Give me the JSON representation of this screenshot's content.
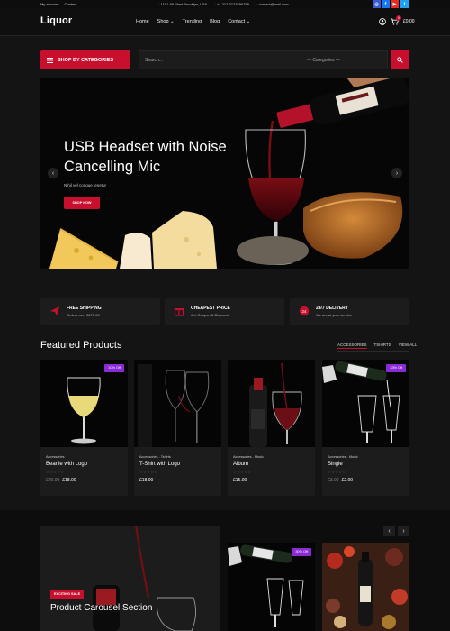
{
  "topbar": {
    "links": [
      "My account",
      "Contact"
    ],
    "contacts": [
      "1101-95 West Brooklyn, USA",
      "+1 212-0123456789",
      "contact@mail.com"
    ],
    "social": [
      {
        "icon": "instagram-icon",
        "color": "#3b5bd6",
        "glyph": "◎"
      },
      {
        "icon": "facebook-icon",
        "color": "#1877f2",
        "glyph": "f"
      },
      {
        "icon": "youtube-icon",
        "color": "#e52d27",
        "glyph": "▶"
      },
      {
        "icon": "twitter-icon",
        "color": "#1da1f2",
        "glyph": "t"
      }
    ]
  },
  "header": {
    "logo": "Liquor",
    "nav": [
      "Home",
      "Shop ⌄",
      "Trending",
      "Blog",
      "Contact ⌄"
    ],
    "cart_count": "0",
    "cart_total": "£0.00"
  },
  "categories_button": "SHOP BY CATEGORIES",
  "search": {
    "placeholder": "Search...",
    "category": "--- Categories ---"
  },
  "hero": {
    "title": "USB Headset with Noise Cancelling Mic",
    "subtitle": "Nihil vel congue tenetur",
    "button": "SHOP NOW"
  },
  "features": [
    {
      "icon": "plane-icon",
      "title": "FREE SHIPPING",
      "sub": "Orders over $175.00"
    },
    {
      "icon": "gift-icon",
      "title": "CHEAPEST PRICE",
      "sub": "Get Coupon & Discount"
    },
    {
      "icon": "support-icon",
      "title": "24/7 DELIVERY",
      "sub": "We are at your service"
    }
  ],
  "featured": {
    "title": "Featured Products",
    "filters": [
      "ACCESSORIES",
      "TSHIRTS",
      "VIEW ALL"
    ],
    "products": [
      {
        "badge": "10% Off",
        "category": "Accessories",
        "name": "Beanie with Logo",
        "old_price": "£20.00",
        "price": "£18.00"
      },
      {
        "badge": "",
        "category": "Accessories - Tshirts",
        "name": "T-Shirt with Logo",
        "old_price": "",
        "price": "£18.00"
      },
      {
        "badge": "",
        "category": "Accessories - Music",
        "name": "Album",
        "old_price": "",
        "price": "£15.00"
      },
      {
        "badge": "33% Off",
        "category": "Accessories - Music",
        "name": "Single",
        "old_price": "£3.00",
        "price": "£2.00"
      }
    ]
  },
  "carousel": {
    "tag": "EXCITING SALE",
    "title": "Product Carousel Section",
    "badge": "30% Off"
  },
  "colors": {
    "accent": "#c8102e",
    "badge": "#8b2bd6",
    "background": "#141414"
  }
}
